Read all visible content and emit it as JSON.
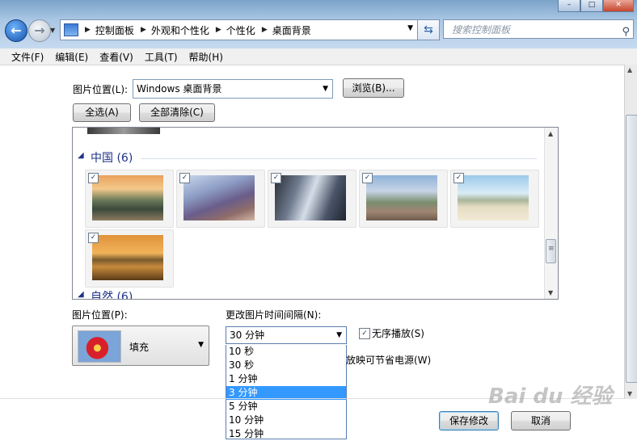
{
  "nav": {
    "breadcrumb": [
      "控制面板",
      "外观和个性化",
      "个性化",
      "桌面背景"
    ],
    "search_placeholder": "搜索控制面板"
  },
  "menu": [
    "文件(F)",
    "编辑(E)",
    "查看(V)",
    "工具(T)",
    "帮助(H)"
  ],
  "picture_location": {
    "label": "图片位置(L):",
    "value": "Windows 桌面背景",
    "browse_label": "浏览(B)...",
    "select_all_label": "全选(A)",
    "clear_all_label": "全部清除(C)"
  },
  "gallery": {
    "groups": [
      {
        "name": "中国 (6)",
        "items": [
          {
            "checked": true,
            "scene": "karst-river"
          },
          {
            "checked": true,
            "scene": "great-wall"
          },
          {
            "checked": true,
            "scene": "mountain-pines"
          },
          {
            "checked": true,
            "scene": "rice-terraces"
          },
          {
            "checked": true,
            "scene": "beach-rocks"
          },
          {
            "checked": true,
            "scene": "arch-bridge-sunset"
          }
        ]
      },
      {
        "name": "自然 (6)"
      }
    ]
  },
  "position": {
    "label": "图片位置(P):",
    "value": "填充"
  },
  "interval": {
    "label": "更改图片时间间隔(N):",
    "value": "30 分钟",
    "options": [
      "10 秒",
      "30 秒",
      "1 分钟",
      "3 分钟",
      "5 分钟",
      "10 分钟",
      "15 分钟"
    ],
    "highlighted_index": 3
  },
  "shuffle": {
    "label": "无序播放(S)",
    "checked": true
  },
  "power_text": "放映可节省电源(W)",
  "buttons": {
    "save": "保存修改",
    "cancel": "取消"
  },
  "colors": {
    "accent": "#3399ff",
    "group_header": "#1e3287"
  }
}
